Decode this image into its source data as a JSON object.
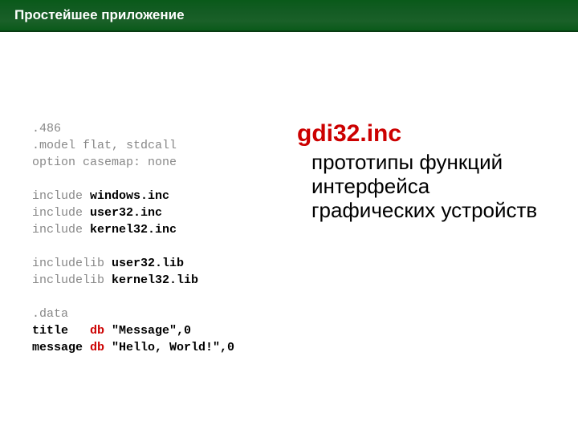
{
  "header": {
    "title": "Простейшее приложение"
  },
  "code": {
    "l1_a": ".486",
    "l2_a": ".model flat, stdcall",
    "l3_a": "option casemap: none",
    "l4_a": "include",
    "l4_b": " windows.inc",
    "l5_a": "include",
    "l5_b": " user32.inc",
    "l6_a": "include",
    "l6_b": " kernel32.inc",
    "l7_a": "includelib",
    "l7_b": " user32.lib",
    "l8_a": "includelib",
    "l8_b": " kernel32.lib",
    "l9_a": ".data",
    "l10_a": "title   ",
    "l10_b": "db",
    "l10_c": " \"Message\",0",
    "l11_a": "message ",
    "l11_b": "db",
    "l11_c": " \"Hello, World!\",0"
  },
  "right": {
    "heading": "gdi32.inc",
    "body": "прототипы функций интерфейса графических устройств"
  }
}
